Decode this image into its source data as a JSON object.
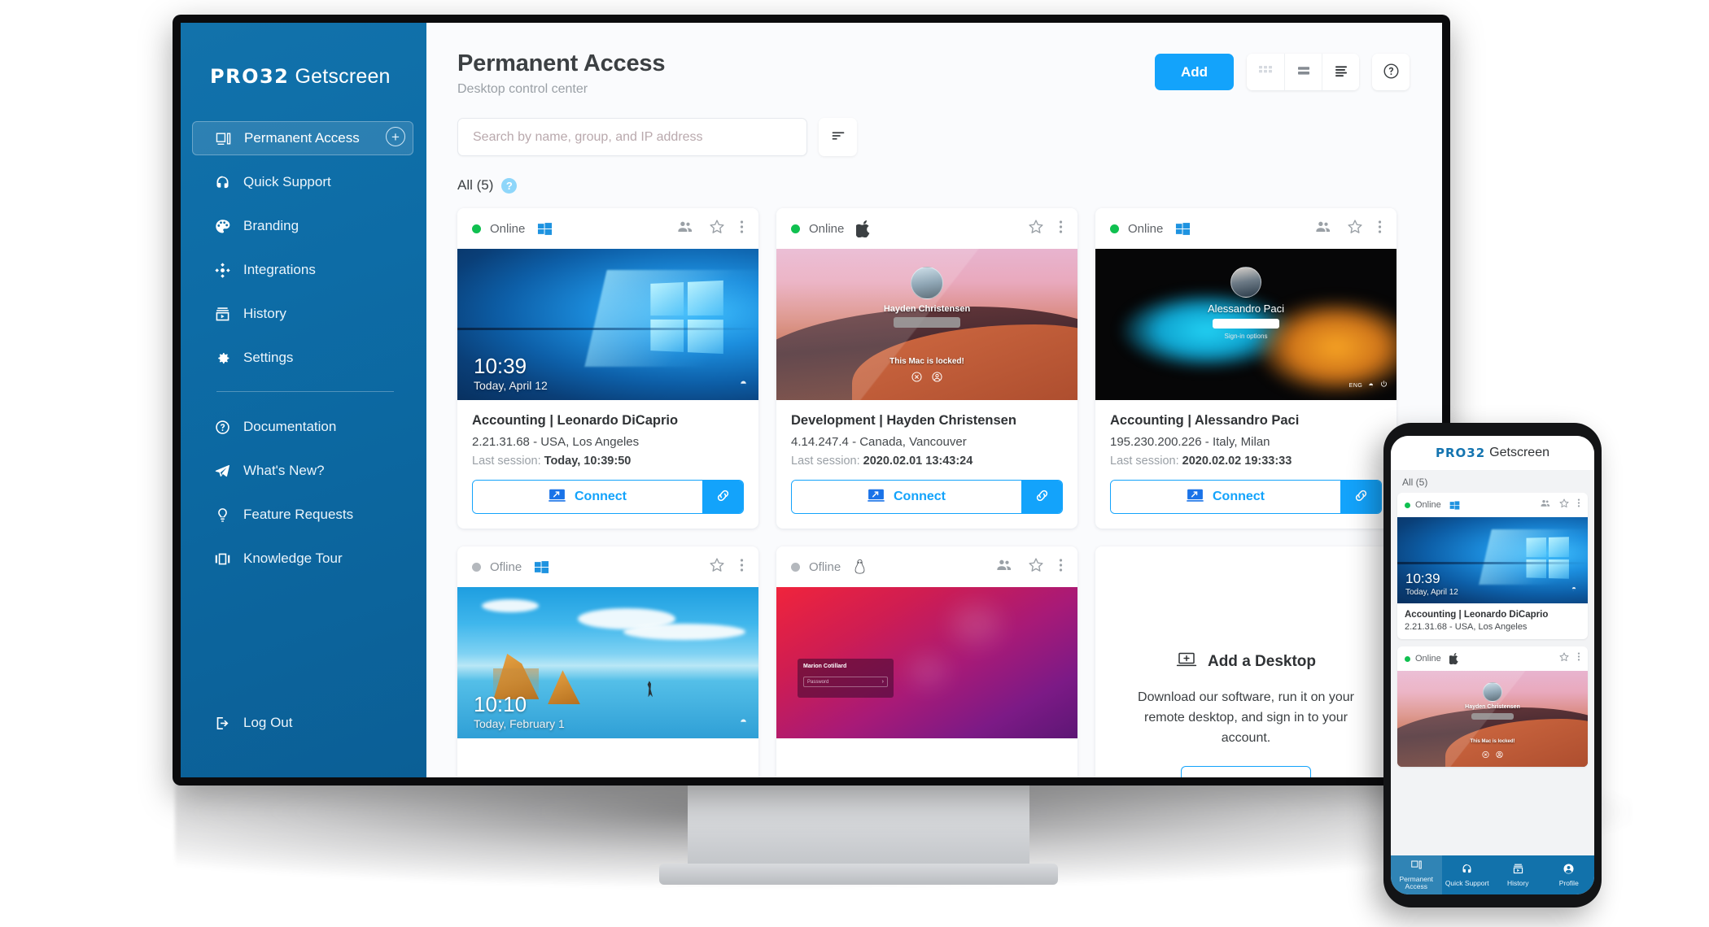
{
  "brand": {
    "pro32": "PRO32",
    "name": "Getscreen"
  },
  "sidebar": {
    "items": [
      {
        "label": "Permanent Access",
        "icon": "monitor-icon",
        "active": true
      },
      {
        "label": "Quick Support",
        "icon": "headset-icon",
        "active": false
      },
      {
        "label": "Branding",
        "icon": "palette-icon",
        "active": false
      },
      {
        "label": "Integrations",
        "icon": "integrations-icon",
        "active": false
      },
      {
        "label": "History",
        "icon": "history-icon",
        "active": false
      },
      {
        "label": "Settings",
        "icon": "gear-icon",
        "active": false
      }
    ],
    "secondary_items": [
      {
        "label": "Documentation",
        "icon": "question-circle-icon"
      },
      {
        "label": "What's New?",
        "icon": "paper-plane-icon"
      },
      {
        "label": "Feature Requests",
        "icon": "lightbulb-icon"
      },
      {
        "label": "Knowledge Tour",
        "icon": "slides-icon"
      }
    ],
    "logout_label": "Log Out",
    "logout_icon": "logout-icon",
    "add_group_icon": "plus-circle-icon"
  },
  "header": {
    "title": "Permanent Access",
    "subtitle": "Desktop control center",
    "add_label": "Add",
    "view_modes": [
      {
        "name": "grid-view",
        "icon": "grid-icon",
        "active": false
      },
      {
        "name": "card-view",
        "icon": "card-rows-icon",
        "active": true
      },
      {
        "name": "list-view",
        "icon": "list-icon",
        "active": false
      }
    ],
    "help_icon": "question-circle-icon"
  },
  "search": {
    "placeholder": "Search by name, group, and IP address",
    "value": "",
    "filter_icon": "filter-icon"
  },
  "group": {
    "label": "All (5)",
    "help_icon": "question-badge-icon"
  },
  "cards": [
    {
      "status": "Online",
      "online": true,
      "os": "windows",
      "has_group_icon": true,
      "thumb": "win10",
      "thumb_time": "10:39",
      "thumb_date": "Today, April 12",
      "title": "Accounting | Leonardo DiCaprio",
      "ip": "2.21.31.68 - USA, Los Angeles",
      "session_label": "Last session:",
      "session_value": "Today, 10:39:50",
      "connect_label": "Connect"
    },
    {
      "status": "Online",
      "online": true,
      "os": "apple",
      "has_group_icon": false,
      "thumb": "mac",
      "lock_name": "Hayden Christensen",
      "lock_msg": "This Mac is locked!",
      "title": "Development | Hayden Christensen",
      "ip": "4.14.247.4 - Canada, Vancouver",
      "session_label": "Last session:",
      "session_value": "2020.02.01 13:43:24",
      "connect_label": "Connect"
    },
    {
      "status": "Online",
      "online": true,
      "os": "windows",
      "has_group_icon": true,
      "thumb": "winlock",
      "lock_name": "Alessandro Paci",
      "lock_opts": "Sign-in options",
      "lock_tray": "ENG",
      "title": "Accounting | Alessandro Paci",
      "ip": "195.230.200.226 - Italy, Milan",
      "session_label": "Last session:",
      "session_value": "2020.02.02 19:33:33",
      "connect_label": "Connect"
    },
    {
      "status": "Ofline",
      "online": false,
      "os": "windows",
      "has_group_icon": false,
      "thumb": "beach",
      "thumb_time": "10:10",
      "thumb_date": "Today, February 1"
    },
    {
      "status": "Ofline",
      "online": false,
      "os": "linux",
      "has_group_icon": true,
      "thumb": "ubuntu",
      "lock_name": "Marion Cotillard",
      "lock_pw_placeholder": "Password"
    }
  ],
  "add_desktop": {
    "title": "Add a Desktop",
    "icon": "laptop-plus-icon",
    "description": "Download our software, run it on your remote desktop, and sign in to your account."
  },
  "phone": {
    "group": "All (5)",
    "cards": [
      {
        "status": "Online",
        "online": true,
        "os": "windows",
        "has_group_icon": true,
        "thumb": "win10",
        "thumb_time": "10:39",
        "thumb_date": "Today, April 12",
        "title": "Accounting | Leonardo DiCaprio",
        "ip": "2.21.31.68 - USA, Los Angeles"
      },
      {
        "status": "Online",
        "online": true,
        "os": "apple",
        "has_group_icon": false,
        "thumb": "mac",
        "lock_name": "Hayden Christensen",
        "lock_msg": "This Mac is locked!"
      }
    ],
    "tabs": [
      {
        "label": "Permanent Access",
        "icon": "monitor-icon",
        "active": true
      },
      {
        "label": "Quick Support",
        "icon": "headset-icon",
        "active": false
      },
      {
        "label": "History",
        "icon": "history-icon",
        "active": false
      },
      {
        "label": "Profile",
        "icon": "profile-icon",
        "active": false
      }
    ]
  },
  "colors": {
    "accent": "#13a3fb",
    "sidebar": "#0d6ca6",
    "online": "#10c050",
    "offline": "#b4b8bd"
  }
}
